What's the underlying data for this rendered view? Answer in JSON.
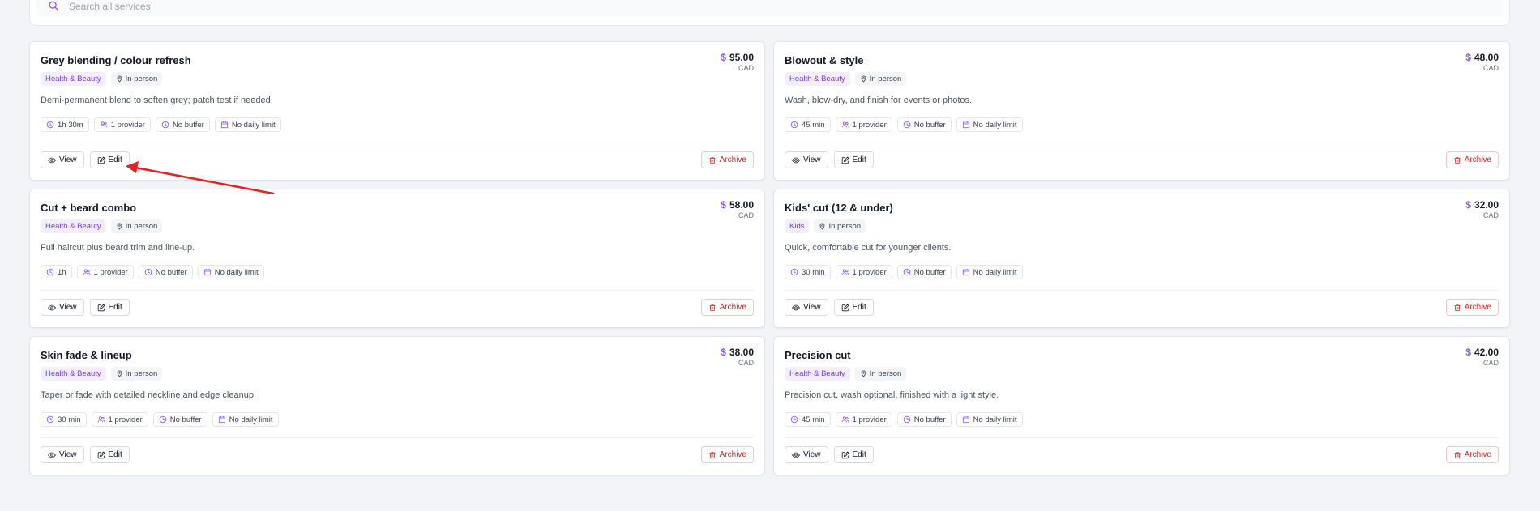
{
  "search": {
    "placeholder": "Search all services"
  },
  "colors": {
    "accent": "#7c3aed",
    "danger": "#dc2626",
    "annotation_arrow": "#e32222"
  },
  "services": [
    {
      "title": "Grey blending / colour refresh",
      "price": "$95.00",
      "currency": "CAD",
      "category": "Health & Beauty",
      "mode": "In person",
      "description": "Demi-permanent blend to soften grey; patch test if needed.",
      "duration": "1h 30m",
      "providers": "1 provider",
      "buffer": "No buffer",
      "limit": "No daily limit",
      "view_label": "View",
      "edit_label": "Edit",
      "archive_label": "Archive"
    },
    {
      "title": "Blowout & style",
      "price": "$48.00",
      "currency": "CAD",
      "category": "Health & Beauty",
      "mode": "In person",
      "description": "Wash, blow-dry, and finish for events or photos.",
      "duration": "45 min",
      "providers": "1 provider",
      "buffer": "No buffer",
      "limit": "No daily limit",
      "view_label": "View",
      "edit_label": "Edit",
      "archive_label": "Archive"
    },
    {
      "title": "Cut + beard combo",
      "price": "$58.00",
      "currency": "CAD",
      "category": "Health & Beauty",
      "mode": "In person",
      "description": "Full haircut plus beard trim and line-up.",
      "duration": "1h",
      "providers": "1 provider",
      "buffer": "No buffer",
      "limit": "No daily limit",
      "view_label": "View",
      "edit_label": "Edit",
      "archive_label": "Archive"
    },
    {
      "title": "Kids' cut (12 & under)",
      "price": "$32.00",
      "currency": "CAD",
      "category": "Kids",
      "mode": "In person",
      "description": "Quick, comfortable cut for younger clients.",
      "duration": "30 min",
      "providers": "1 provider",
      "buffer": "No buffer",
      "limit": "No daily limit",
      "view_label": "View",
      "edit_label": "Edit",
      "archive_label": "Archive"
    },
    {
      "title": "Skin fade & lineup",
      "price": "$38.00",
      "currency": "CAD",
      "category": "Health & Beauty",
      "mode": "In person",
      "description": "Taper or fade with detailed neckline and edge cleanup.",
      "duration": "30 min",
      "providers": "1 provider",
      "buffer": "No buffer",
      "limit": "No daily limit",
      "view_label": "View",
      "edit_label": "Edit",
      "archive_label": "Archive"
    },
    {
      "title": "Precision cut",
      "price": "$42.00",
      "currency": "CAD",
      "category": "Health & Beauty",
      "mode": "In person",
      "description": "Precision cut, wash optional, finished with a light style.",
      "duration": "45 min",
      "providers": "1 provider",
      "buffer": "No buffer",
      "limit": "No daily limit",
      "view_label": "View",
      "edit_label": "Edit",
      "archive_label": "Archive"
    }
  ]
}
